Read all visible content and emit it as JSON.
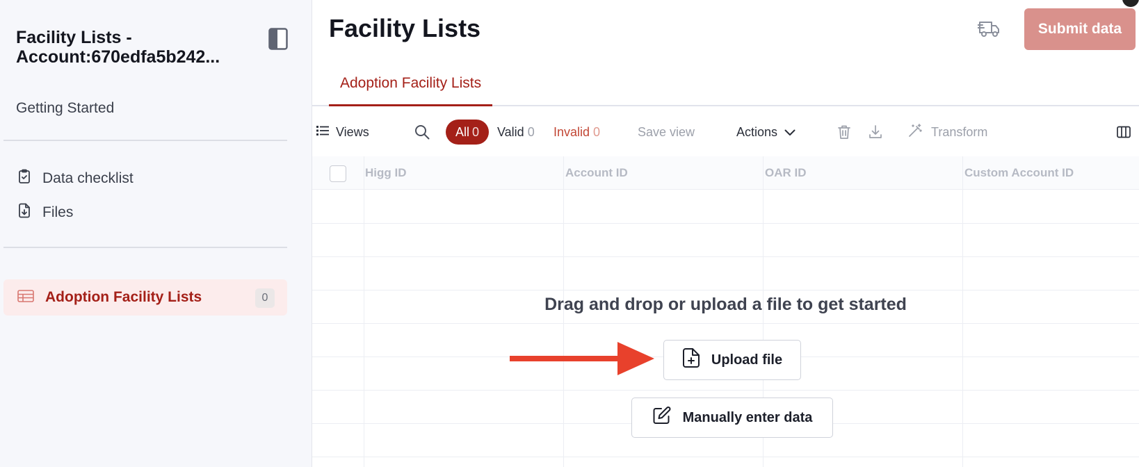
{
  "sidebar": {
    "title": "Facility Lists - Account:670edfa5b242...",
    "getting_started": "Getting Started",
    "items": [
      {
        "label": "Data checklist",
        "icon": "clipboard-check-icon"
      },
      {
        "label": "Files",
        "icon": "file-download-icon"
      }
    ],
    "active_sheet": {
      "label": "Adoption Facility Lists",
      "count": "0",
      "icon": "table-icon"
    }
  },
  "header": {
    "title": "Facility Lists",
    "submit_label": "Submit data"
  },
  "tabs": [
    {
      "label": "Adoption Facility Lists"
    }
  ],
  "toolbar": {
    "views_label": "Views",
    "filters": {
      "all_label": "All",
      "all_count": "0",
      "valid_label": "Valid",
      "valid_count": "0",
      "invalid_label": "Invalid",
      "invalid_count": "0"
    },
    "save_view_label": "Save view",
    "actions_label": "Actions",
    "transform_label": "Transform"
  },
  "grid": {
    "columns": [
      "Higg ID",
      "Account ID",
      "OAR ID",
      "Custom Account ID"
    ]
  },
  "empty_state": {
    "message": "Drag and drop or upload a file to get started",
    "upload_label": "Upload file",
    "manual_label": "Manually enter data"
  },
  "colors": {
    "accent": "#a42018",
    "submit_disabled": "#d9918c",
    "arrow": "#e8412c"
  }
}
